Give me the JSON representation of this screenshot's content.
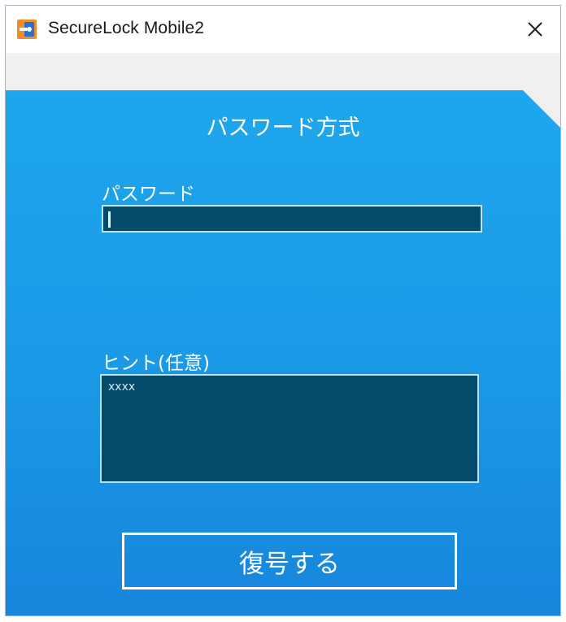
{
  "window": {
    "title": "SecureLock Mobile2",
    "app_icon": "securelock-app-icon",
    "close_icon": "close-icon"
  },
  "panel": {
    "mode_title": "パスワード方式",
    "password": {
      "label": "パスワード",
      "value": ""
    },
    "hint": {
      "label": "ヒント(任意)",
      "value": "xxxx"
    },
    "decrypt_button_label": "復号する"
  },
  "colors": {
    "panel_blue": "#1ea7ec",
    "field_dark": "#044a6a",
    "icon_orange": "#f28c28",
    "icon_blue": "#2a6fd1"
  }
}
